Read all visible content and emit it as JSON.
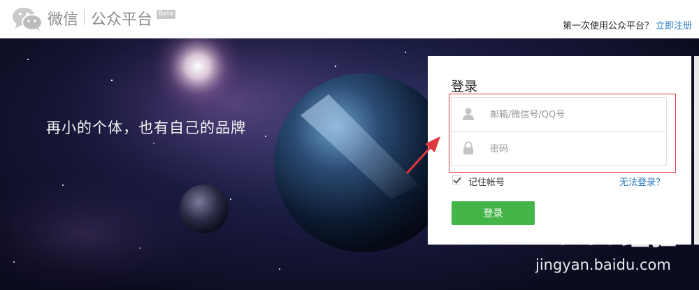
{
  "header": {
    "brand": "微信",
    "sub": "公众平台",
    "beta": "Beta",
    "register_question": "第一次使用公众平台？",
    "register_link": "立即注册"
  },
  "hero": {
    "slogan": "再小的个体，也有自己的品牌"
  },
  "login": {
    "title": "登录",
    "account_placeholder": "邮箱/微信号/QQ号",
    "password_placeholder": "密码",
    "remember_label": "记住帐号",
    "remember_checked": true,
    "forgot_link": "无法登录？",
    "submit_label": "登录"
  },
  "watermark": {
    "brand": "Baidu经验",
    "url": "jingyan.baidu.com"
  },
  "colors": {
    "accent_green": "#44b549",
    "link_blue": "#2a7cc4",
    "highlight_red": "#e0383f"
  }
}
